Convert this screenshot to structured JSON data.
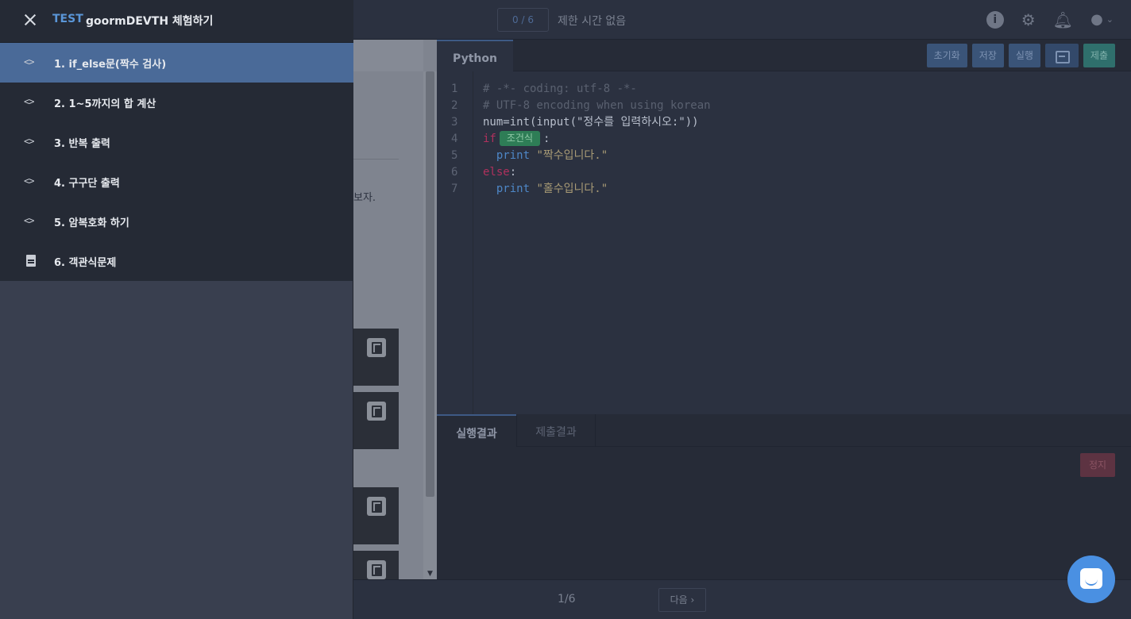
{
  "topbar": {
    "progress": "0 / 6",
    "time_limit": "제한 시간 없음",
    "icons": [
      "info-icon",
      "gear-icon",
      "bell-icon",
      "user-icon",
      "chevron-down-icon"
    ]
  },
  "problem": {
    "text_fragment": "보자."
  },
  "editor": {
    "language_tab": "Python",
    "buttons": {
      "reset": "초기화",
      "save": "저장",
      "run": "실행",
      "submit": "제출"
    },
    "lines": [
      {
        "n": "1",
        "text": "# -*- coding: utf-8 -*-"
      },
      {
        "n": "2",
        "text": "# UTF-8 encoding when using korean"
      },
      {
        "n": "3",
        "text": "num=int(input(\"정수를 입력하시오:\"))"
      },
      {
        "n": "4",
        "kw": "if",
        "chip": "조건식",
        "after": ":"
      },
      {
        "n": "5",
        "fn": "print",
        "str": "\"짝수입니다.\""
      },
      {
        "n": "6",
        "kw": "else",
        "after": ":"
      },
      {
        "n": "7",
        "fn": "print",
        "str": "\"홀수입니다.\""
      }
    ]
  },
  "output": {
    "tabs": {
      "run_result": "실행결과",
      "submit_result": "제출결과"
    },
    "stop": "정지"
  },
  "bottombar": {
    "page": "1/6",
    "next": "다음 ›"
  },
  "drawer": {
    "badge": "TEST",
    "title": "goormDEVTH 체험하기",
    "items": [
      {
        "label": "1. if_else문(짝수 검사)",
        "icon": "code-icon"
      },
      {
        "label": "2. 1~5까지의 합 계산",
        "icon": "code-icon"
      },
      {
        "label": "3. 반복 출력",
        "icon": "code-icon"
      },
      {
        "label": "4. 구구단 출력",
        "icon": "code-icon"
      },
      {
        "label": "5. 암복호화 하기",
        "icon": "code-icon"
      },
      {
        "label": "6. 객관식문제",
        "icon": "document-icon"
      }
    ]
  },
  "colors": {
    "accent": "#4a6a98",
    "badge": "#5a96d8",
    "submit": "#2f6f6c",
    "chip": "#2e7d56"
  }
}
